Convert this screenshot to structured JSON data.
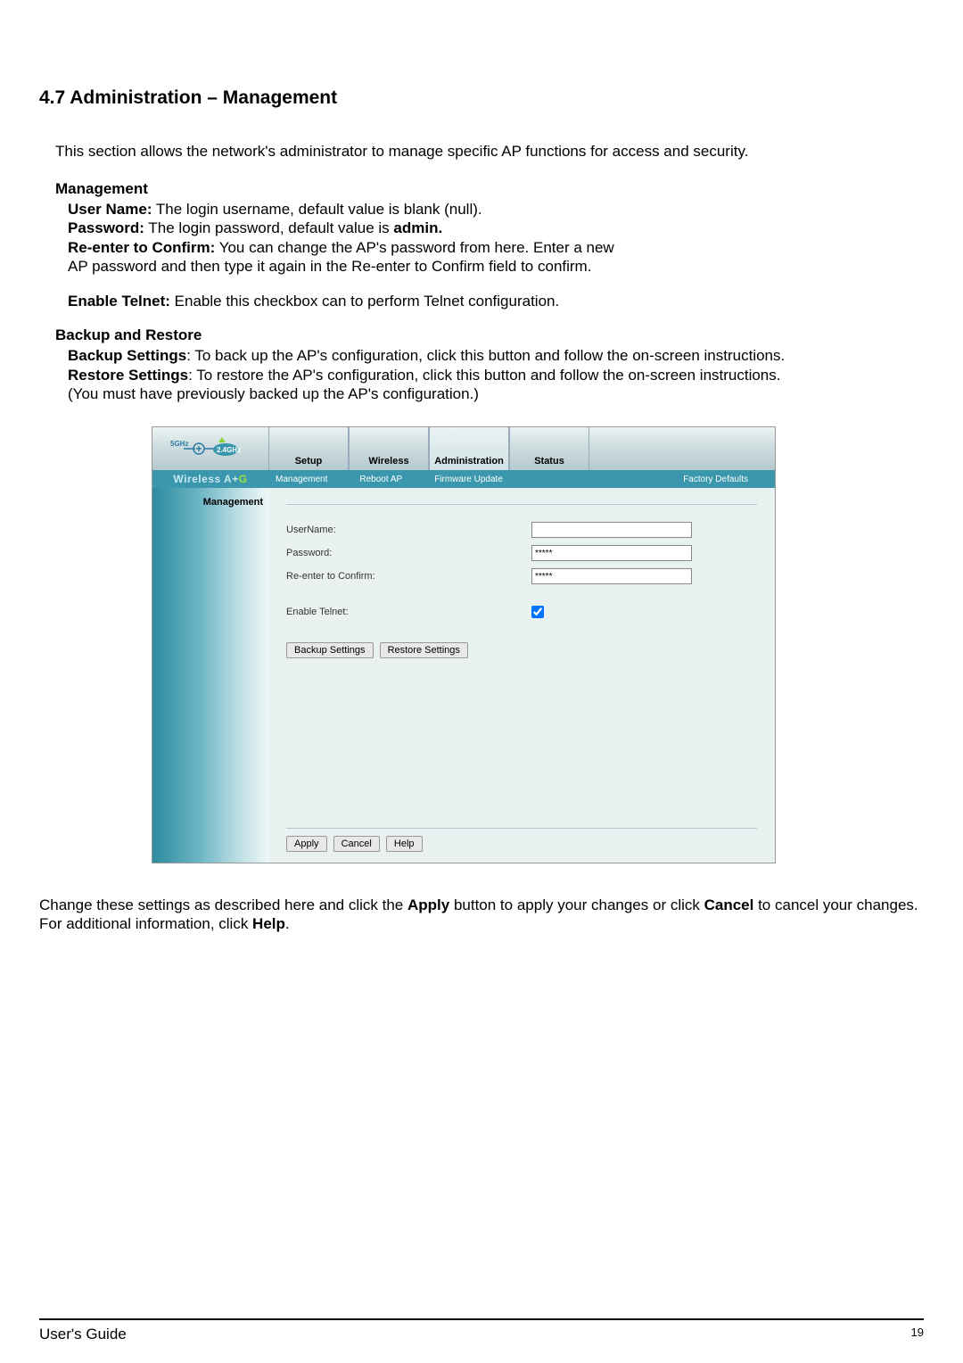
{
  "heading": "4.7 Administration – Management",
  "intro": "This section allows the network's administrator to manage specific AP functions for access and security.",
  "management": {
    "title": "Management",
    "username_label": "User Name:",
    "username_desc": " The login username, default value is blank (null).",
    "password_label": "Password:",
    "password_desc": " The login password, default value is ",
    "password_bold": "admin.",
    "reenter_label": "Re-enter to Confirm:",
    "reenter_desc": " You can change the AP's password from here. Enter a new",
    "reenter_desc2": "AP password and then type it again in the Re-enter to Confirm field to confirm.",
    "telnet_label": "Enable Telnet:",
    "telnet_desc": " Enable this checkbox can to perform Telnet configuration."
  },
  "backup": {
    "title": "Backup and Restore",
    "backup_label": "Backup Settings",
    "backup_desc": ": To back up the AP's configuration, click this button and follow the on-screen instructions.",
    "restore_label": "Restore Settings",
    "restore_desc": ": To restore the AP's configuration, click this button and follow the on-screen instructions.",
    "note": "(You must have previously backed up the AP's configuration.)"
  },
  "screenshot": {
    "logo_left": "5GHz",
    "logo_right": "2.4GHz",
    "brand_prefix": "Wireless A+",
    "brand_suffix": "G",
    "tabs": [
      "Setup",
      "Wireless",
      "Administration",
      "Status"
    ],
    "subtabs": [
      "Management",
      "Reboot AP",
      "Firmware Update",
      "Factory Defaults"
    ],
    "sidebar_label": "Management",
    "form": {
      "username": "UserName:",
      "username_value": "",
      "password": "Password:",
      "password_value": "*****",
      "reenter": "Re-enter to Confirm:",
      "reenter_value": "*****",
      "telnet": "Enable Telnet:"
    },
    "buttons": {
      "backup": "Backup Settings",
      "restore": "Restore Settings",
      "apply": "Apply",
      "cancel": "Cancel",
      "help": "Help"
    }
  },
  "outro_pre": "Change these settings as described here and click the ",
  "outro_apply": "Apply",
  "outro_mid": " button to apply your changes or click ",
  "outro_cancel": "Cancel",
  "outro_mid2": " to cancel your changes. For additional information, click ",
  "outro_help": "Help",
  "outro_end": ".",
  "footer_left": "User's Guide",
  "footer_right": "19"
}
